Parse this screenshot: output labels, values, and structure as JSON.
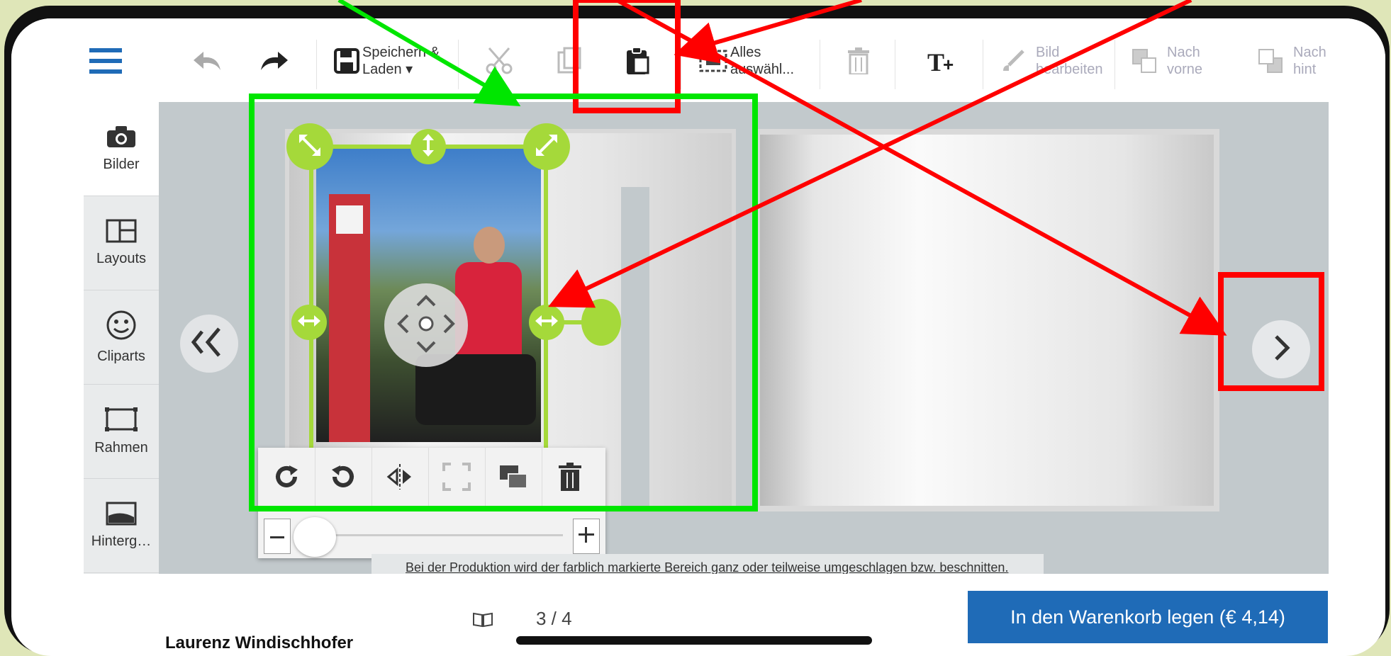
{
  "toolbar": {
    "menu_icon": "hamburger-icon",
    "undo_icon": "undo-icon",
    "redo_icon": "redo-icon",
    "save": {
      "line1": "Speichern &",
      "line2": "Laden ▾"
    },
    "cut_icon": "scissors-icon",
    "copy_icon": "copy-icon",
    "paste_icon": "paste-icon",
    "select_all": {
      "line1": "Alles",
      "line2": "auswähl..."
    },
    "delete_icon": "trash-icon",
    "add_text_icon": "add-text-icon",
    "edit_image": {
      "line1": "Bild",
      "line2": "bearbeiten"
    },
    "bring_forward": {
      "line1": "Nach",
      "line2": "vorne"
    },
    "send_back": {
      "line1": "Nach",
      "line2": "hint"
    }
  },
  "sidebar": {
    "items": [
      {
        "label": "Bilder",
        "icon": "camera-icon"
      },
      {
        "label": "Layouts",
        "icon": "layout-icon"
      },
      {
        "label": "Cliparts",
        "icon": "smiley-icon"
      },
      {
        "label": "Rahmen",
        "icon": "frame-icon"
      },
      {
        "label": "Hinterg…",
        "icon": "background-icon"
      }
    ]
  },
  "canvas": {
    "hint_text": "Bei der Produktion wird der farblich markierte Bereich ganz oder teilweise umgeschlagen bzw. beschnitten."
  },
  "edit_panel": {
    "buttons": [
      "rotate-right-icon",
      "rotate-left-icon",
      "flip-icon",
      "fit-icon",
      "swap-image-icon",
      "trash-icon"
    ],
    "zoom_level": 0
  },
  "bottom": {
    "page_indicator": "3 / 4",
    "book_icon": "book-icon",
    "cart_button": "In den Warenkorb legen (€ 4,14)"
  },
  "author": "Laurenz Windischhofer",
  "colors": {
    "accent_green": "#a5d93a",
    "annotation_red": "#ff0000",
    "annotation_green": "#00e600",
    "cart_blue": "#1f6bb7"
  }
}
